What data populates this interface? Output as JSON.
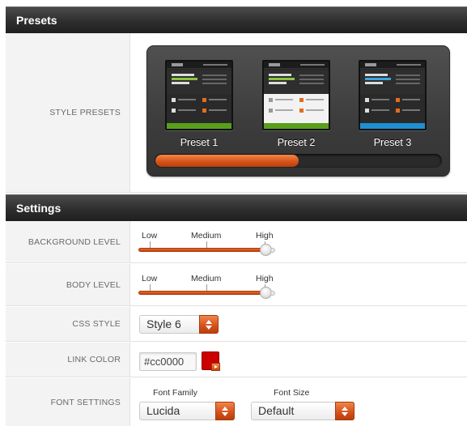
{
  "presets_section": {
    "title": "Presets"
  },
  "style_presets": {
    "label": "STYLE PRESETS",
    "items": [
      {
        "name": "Preset 1",
        "accent": "#5a9e1c"
      },
      {
        "name": "Preset 2",
        "accent": "#5a9e1c"
      },
      {
        "name": "Preset 3",
        "accent": "#1f8fd1"
      }
    ],
    "scroll_position": 0.5
  },
  "settings_section": {
    "title": "Settings"
  },
  "background_level": {
    "label": "BACKGROUND LEVEL",
    "low": "Low",
    "medium": "Medium",
    "high": "High",
    "value": "High"
  },
  "body_level": {
    "label": "BODY LEVEL",
    "low": "Low",
    "medium": "Medium",
    "high": "High",
    "value": "High"
  },
  "css_style": {
    "label": "CSS STYLE",
    "value": "Style 6"
  },
  "link_color": {
    "label": "LINK COLOR",
    "value": "#cc0000",
    "swatch": "#cc0000"
  },
  "font_settings": {
    "label": "FONT SETTINGS",
    "family_label": "Font Family",
    "family_value": "Lucida",
    "size_label": "Font Size",
    "size_value": "Default"
  },
  "colors": {
    "accent": "#d8541a",
    "header_bg": "#2e2e2e"
  }
}
